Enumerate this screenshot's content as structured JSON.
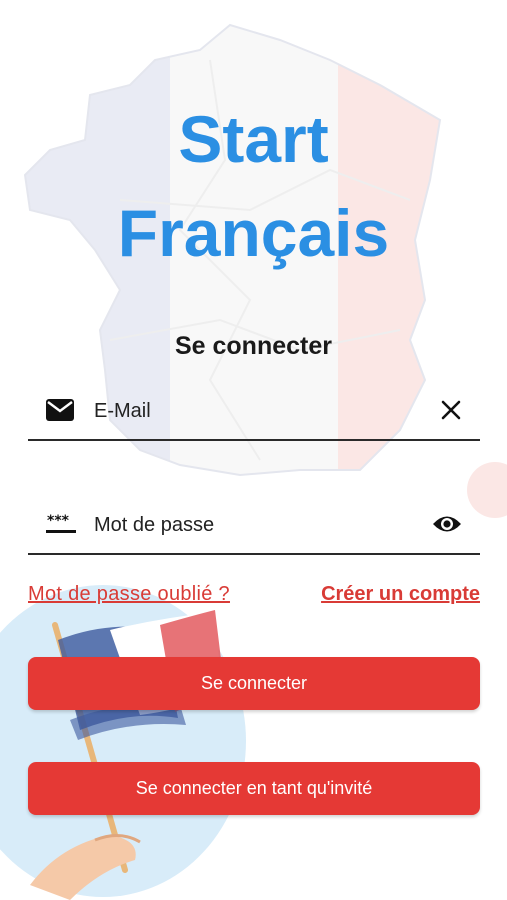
{
  "app": {
    "title_line1": "Start",
    "title_line2": "Français",
    "subtitle": "Se connecter"
  },
  "form": {
    "email": {
      "placeholder": "E-Mail",
      "value": "",
      "lead_icon": "mail-icon",
      "trail_icon": "close-icon"
    },
    "password": {
      "placeholder": "Mot de passe",
      "value": "",
      "lead_icon": "password-icon",
      "trail_icon": "eye-icon"
    }
  },
  "links": {
    "forgot_password": "Mot de passe oublié ?",
    "create_account": "Créer un compte"
  },
  "buttons": {
    "login": "Se connecter",
    "guest": "Se connecter en tant qu'invité"
  },
  "colors": {
    "title_blue": "#2b8fe3",
    "accent_red": "#e53935",
    "link_red": "#d93b36",
    "flag_blue": "#3d5a9e",
    "flag_red": "#e35a5f"
  }
}
